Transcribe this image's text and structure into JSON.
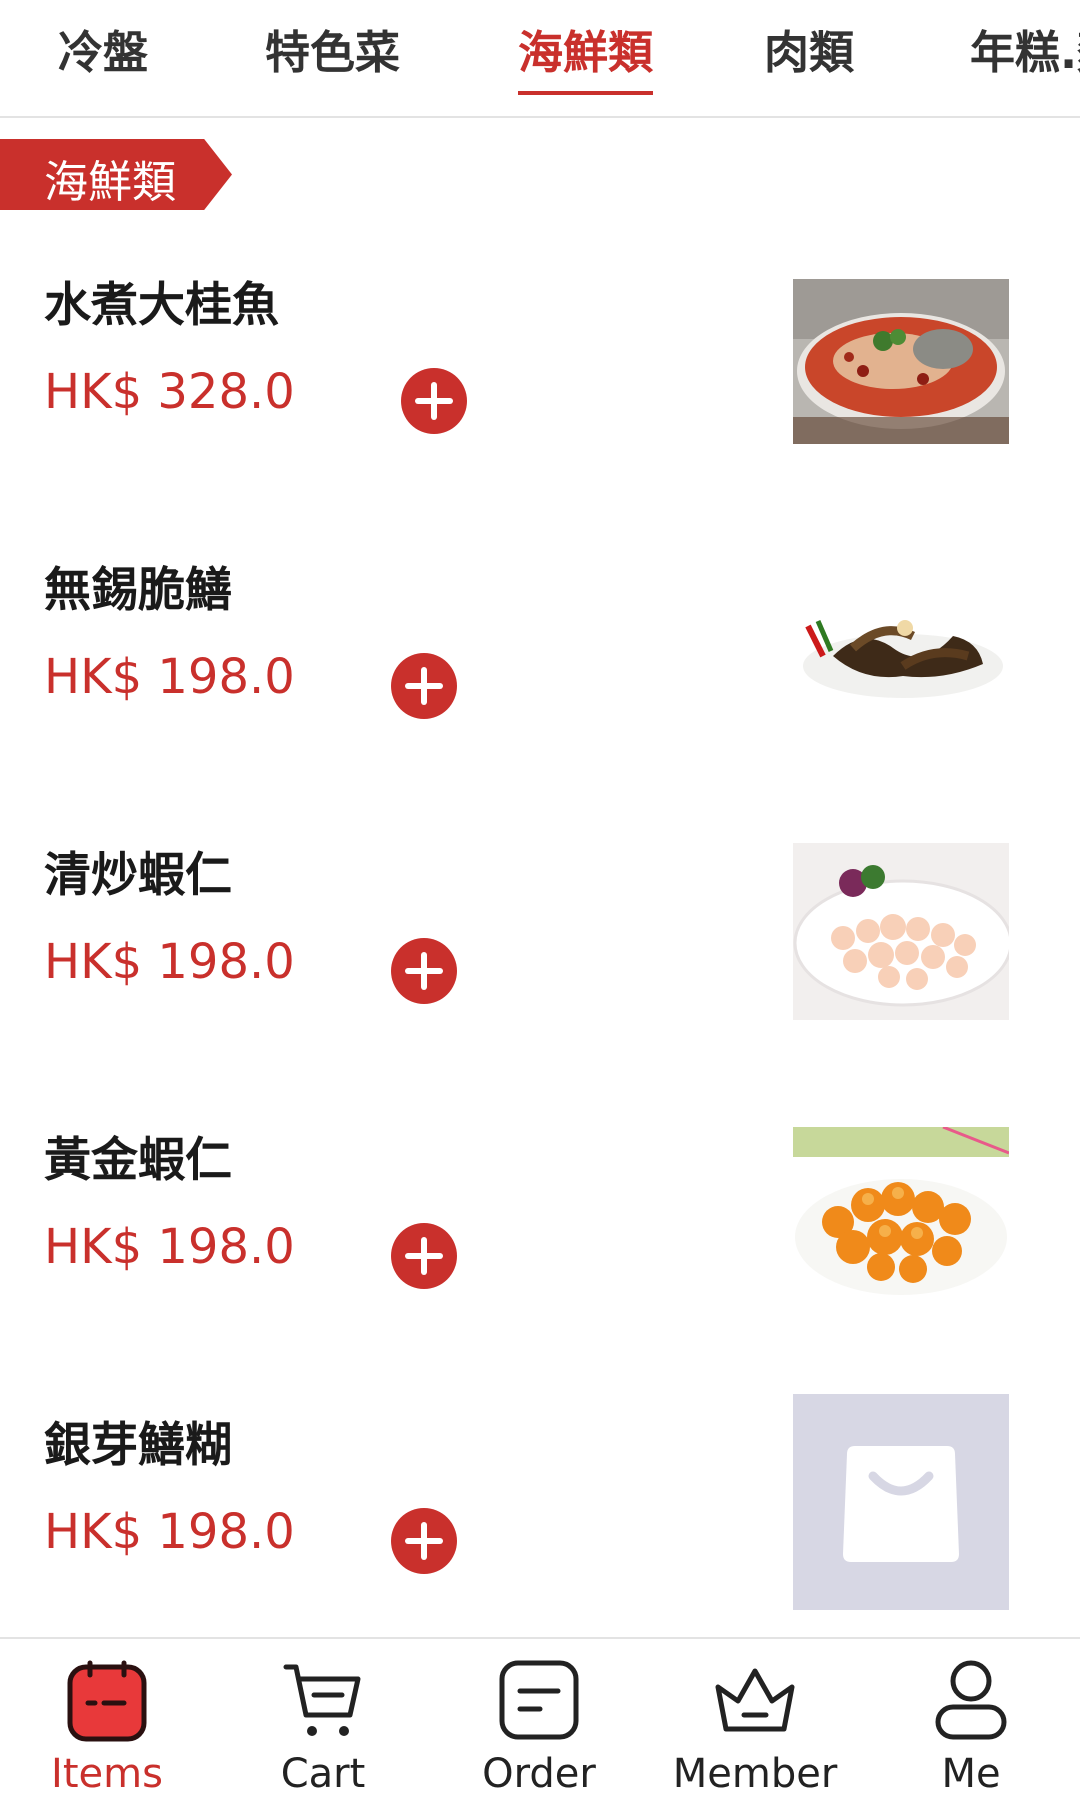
{
  "tabs": [
    {
      "label": "冷盤"
    },
    {
      "label": "特色菜"
    },
    {
      "label": "海鮮類",
      "active": true
    },
    {
      "label": "肉類"
    },
    {
      "label": "年糕.麵"
    }
  ],
  "section": {
    "title": "海鮮類"
  },
  "items": [
    {
      "name": "水煮大桂魚",
      "price": "HK$ 328.0",
      "image": "spicy-boiled-fish-photo"
    },
    {
      "name": "無錫脆鱔",
      "price": "HK$ 198.0",
      "image": "crispy-eel-photo"
    },
    {
      "name": "清炒蝦仁",
      "price": "HK$ 198.0",
      "image": "stir-fried-shrimp-photo"
    },
    {
      "name": "黃金蝦仁",
      "price": "HK$ 198.0",
      "image": "golden-shrimp-photo"
    },
    {
      "name": "銀芽鱔糊",
      "price": "HK$ 198.0",
      "image": "placeholder-bag-icon"
    }
  ],
  "bottom_nav": [
    {
      "label": "Items",
      "icon": "items-icon",
      "active": true
    },
    {
      "label": "Cart",
      "icon": "cart-icon"
    },
    {
      "label": "Order",
      "icon": "order-icon"
    },
    {
      "label": "Member",
      "icon": "crown-icon"
    },
    {
      "label": "Me",
      "icon": "person-icon"
    }
  ],
  "colors": {
    "accent": "#c9302c",
    "text": "#1a1a1a",
    "divider": "#ededed",
    "placeholder_bg": "#d7d7e4"
  }
}
